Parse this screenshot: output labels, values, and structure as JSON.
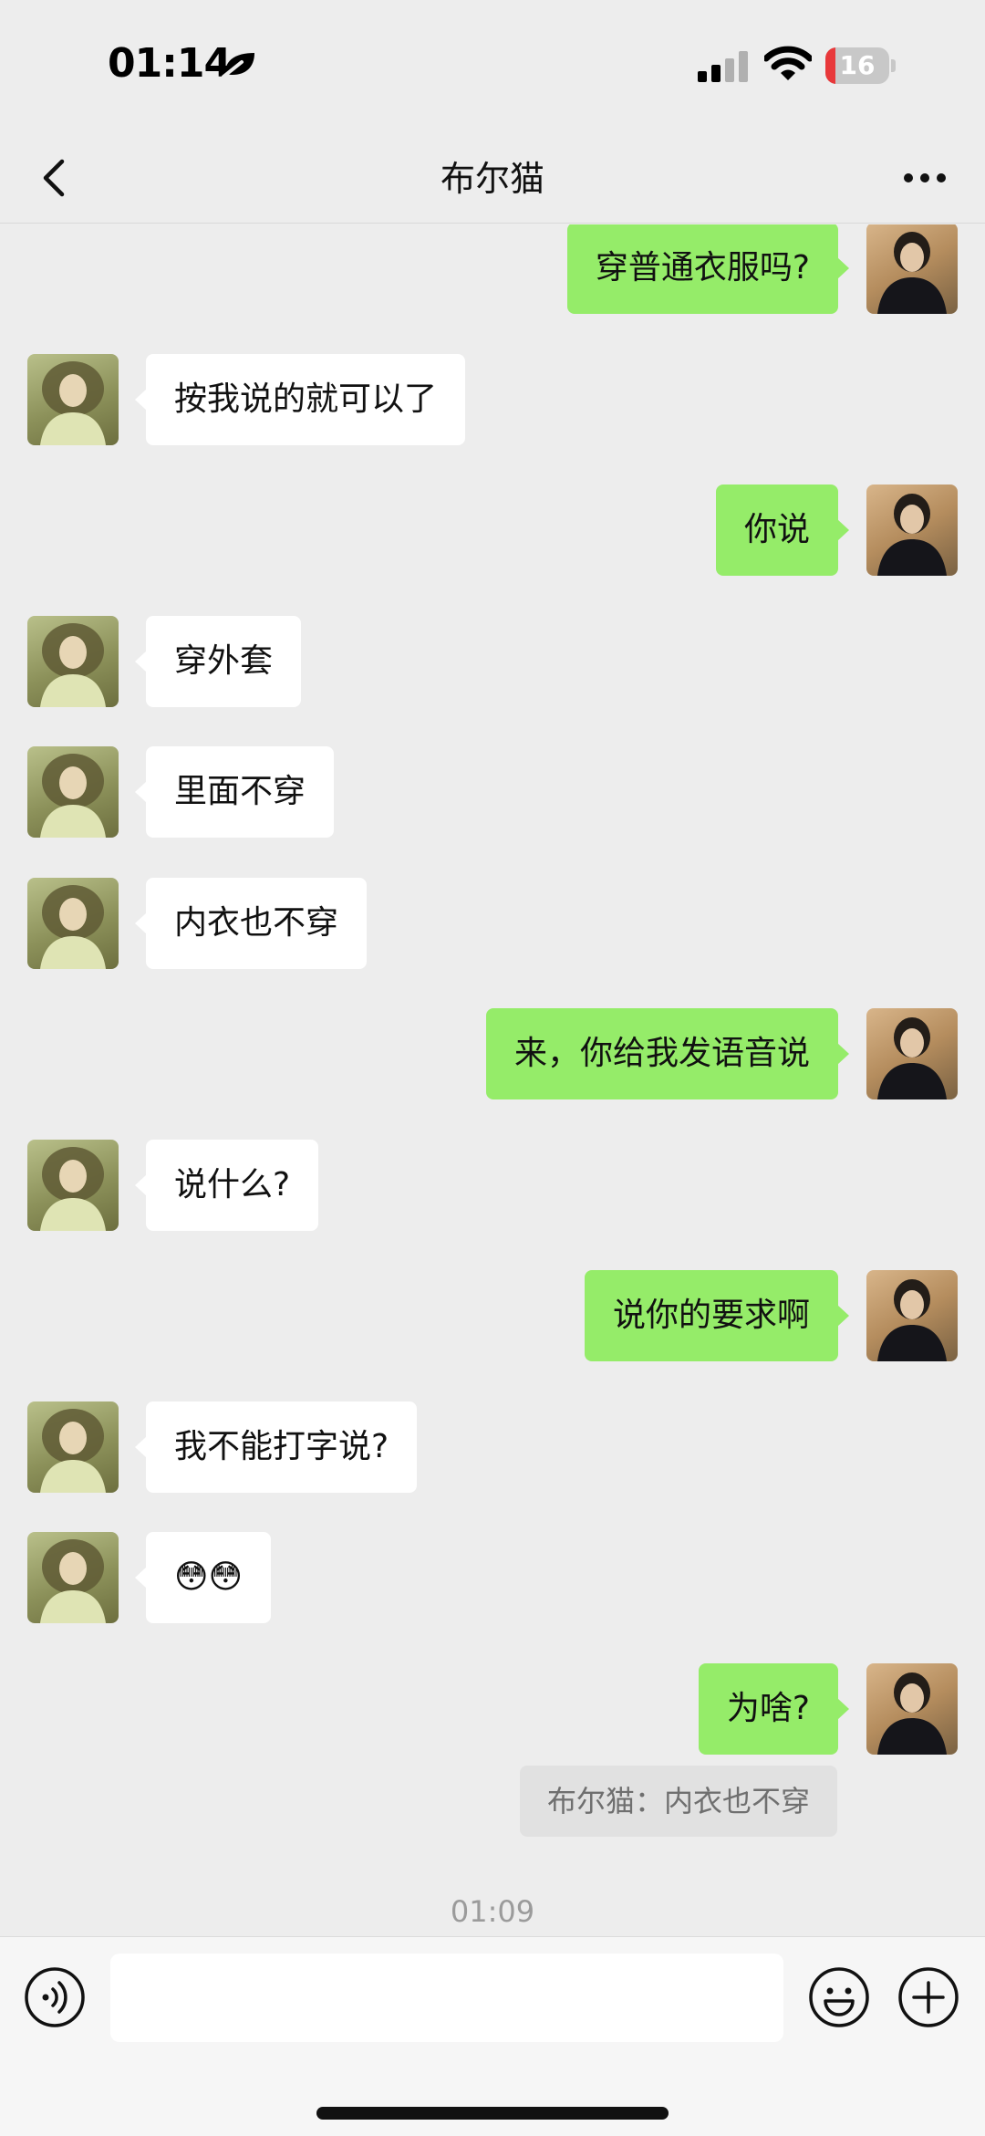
{
  "status_bar": {
    "time": "01:14",
    "battery_level": "16",
    "battery_fraction": 0.16,
    "icons": [
      "focus-leaf-icon",
      "cellular-signal-icon",
      "wifi-icon",
      "battery-icon"
    ]
  },
  "nav": {
    "title": "布尔猫",
    "back_icon": "chevron-left-icon",
    "more_icon": "more-dots-icon"
  },
  "messages": [
    {
      "side": "right",
      "text": "穿普通衣服吗?"
    },
    {
      "side": "left",
      "text": "按我说的就可以了"
    },
    {
      "side": "right",
      "text": "你说"
    },
    {
      "side": "left",
      "text": "穿外套"
    },
    {
      "side": "left",
      "text": "里面不穿"
    },
    {
      "side": "left",
      "text": "内衣也不穿"
    },
    {
      "side": "right",
      "text": "来，你给我发语音说"
    },
    {
      "side": "left",
      "text": "说什么?"
    },
    {
      "side": "right",
      "text": "说你的要求啊"
    },
    {
      "side": "left",
      "text": "我不能打字说?"
    },
    {
      "side": "left",
      "text": "😳😳"
    },
    {
      "side": "right",
      "text": "为啥?"
    }
  ],
  "quote": "布尔猫：内衣也不穿",
  "timestamp": "01:09",
  "input_bar": {
    "placeholder": "",
    "voice_icon": "voice-icon",
    "emoji_icon": "emoji-icon",
    "plus_icon": "plus-icon"
  },
  "colors": {
    "background": "#ededed",
    "sent_bubble": "#95ec69",
    "received_bubble": "#ffffff",
    "battery_low": "#e8383a"
  }
}
